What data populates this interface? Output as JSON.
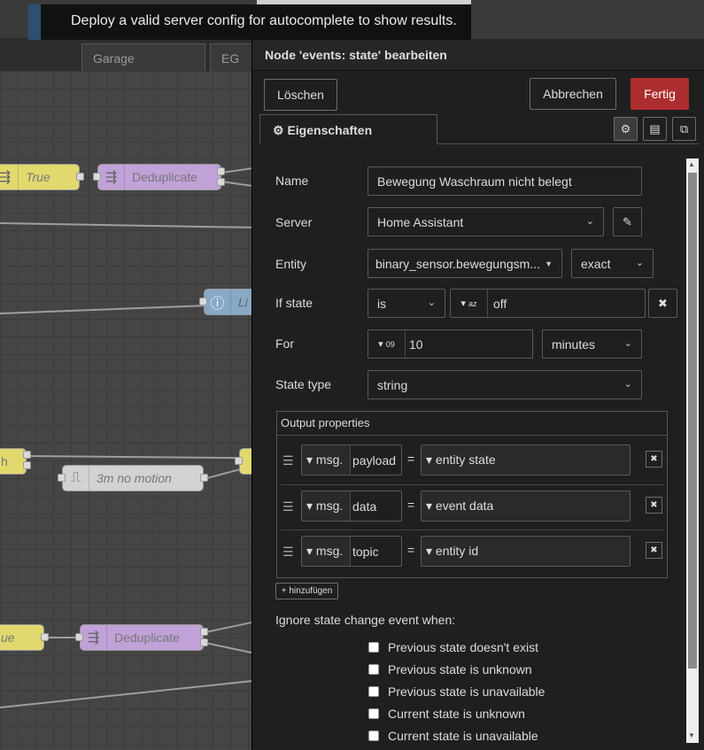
{
  "toast": {
    "message": "Deploy a valid server config for autocomplete to show results."
  },
  "workspace": {
    "tabs": [
      "",
      "Garage",
      "EG"
    ],
    "nodes": [
      {
        "label": "True"
      },
      {
        "label": "Deduplicate"
      },
      {
        "label": "Li"
      },
      {
        "label": "h"
      },
      {
        "label": "3m no motion"
      },
      {
        "label": "ue"
      },
      {
        "label": "Deduplicate"
      }
    ]
  },
  "tray": {
    "title": "Node 'events: state' bearbeiten",
    "delete_label": "Löschen",
    "cancel_label": "Abbrechen",
    "done_label": "Fertig",
    "properties_tab": "Eigenschaften"
  },
  "form": {
    "name_label": "Name",
    "name_value": "Bewegung Waschraum nicht belegt",
    "server_label": "Server",
    "server_value": "Home Assistant",
    "entity_label": "Entity",
    "entity_value": "binary_sensor.bewegungsm...",
    "entity_match": "exact",
    "ifstate_label": "If state",
    "ifstate_op": "is",
    "ifstate_value": "off",
    "for_label": "For",
    "for_value": "10",
    "for_unit": "minutes",
    "statetype_label": "State type",
    "statetype_value": "string",
    "output_label": "Output properties",
    "outputs": [
      {
        "prefix": "msg.",
        "property": "payload",
        "value": "entity state"
      },
      {
        "prefix": "msg.",
        "property": "data",
        "value": "event data"
      },
      {
        "prefix": "msg.",
        "property": "topic",
        "value": "entity id"
      }
    ],
    "add_label": "hinzufügen",
    "ignore_label": "Ignore state change event when:",
    "ignore_options": [
      "Previous state doesn't exist",
      "Previous state is unknown",
      "Previous state is unavailable",
      "Current state is unknown",
      "Current state is unavailable"
    ]
  },
  "colors": {
    "accent_done": "#ac2d2d",
    "node_yellow": "#e2d96e",
    "node_purple": "#c0a2d8",
    "node_blue": "#87a9c6",
    "node_gray": "#d2d2d2"
  }
}
